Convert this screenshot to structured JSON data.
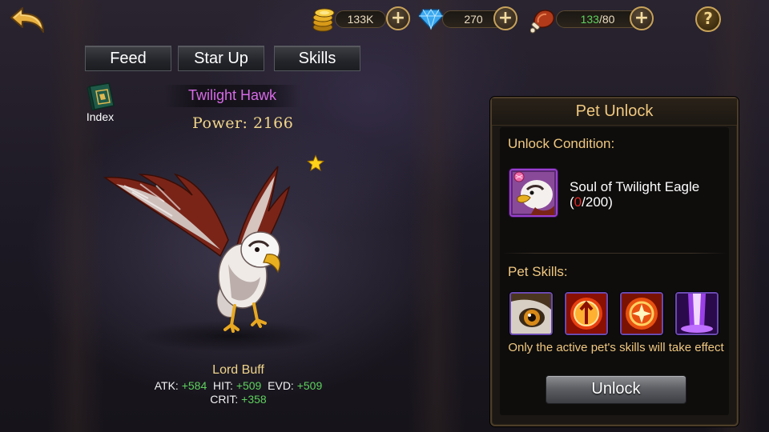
{
  "resources": {
    "gold": "133K",
    "diamonds": "270",
    "stamina_current": "133",
    "stamina_max": "/80"
  },
  "tabs": [
    {
      "label": "Feed"
    },
    {
      "label": "Star Up"
    },
    {
      "label": "Skills"
    }
  ],
  "index_label": "Index",
  "pet": {
    "name": "Twilight Hawk",
    "power_label": "Power:",
    "power_value": "2166",
    "stars": 1
  },
  "buff": {
    "name": "Lord Buff",
    "atk_label": "ATK:",
    "atk_value": "+584",
    "hit_label": "HIT:",
    "hit_value": "+509",
    "evd_label": "EVD:",
    "evd_value": "+509",
    "crit_label": "CRIT:",
    "crit_value": "+358"
  },
  "panel": {
    "title": "Pet Unlock",
    "unlock_condition_label": "Unlock Condition:",
    "soul_name": "Soul of Twilight Eagle",
    "soul_open": "(",
    "soul_have": "0",
    "soul_need": "/200)",
    "pet_skills_label": "Pet Skills:",
    "skills_note": "Only the active pet's skills will take effect",
    "unlock_button": "Unlock"
  },
  "colors": {
    "accent_gold": "#f0c880",
    "pet_name": "#d86ae8",
    "stat_green": "#5ed25e",
    "red": "#e02828"
  }
}
